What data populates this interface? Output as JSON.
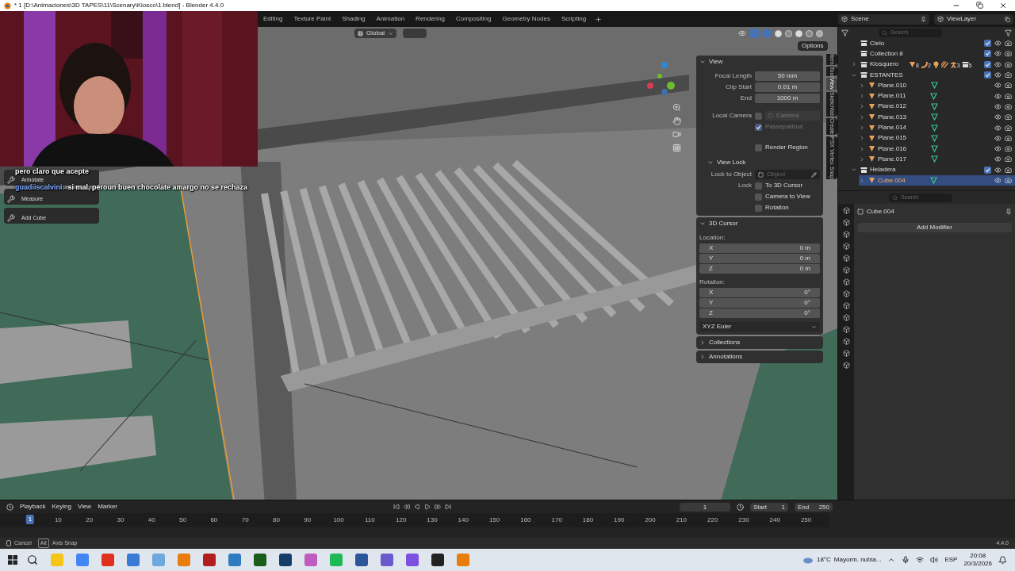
{
  "title_bar": {
    "title": "* 1 [D:\\Animaciones\\3D TAPES\\11\\Scenary\\Kiosco\\1.blend] - Blender 4.4.0"
  },
  "workspaces": [
    {
      "label": "Editing",
      "selected": false
    },
    {
      "label": "Texture Paint",
      "selected": false
    },
    {
      "label": "Shading",
      "selected": false
    },
    {
      "label": "Animation",
      "selected": false
    },
    {
      "label": "Rendering",
      "selected": false
    },
    {
      "label": "Compositing",
      "selected": false
    },
    {
      "label": "Geometry Nodes",
      "selected": false
    },
    {
      "label": "Scripting",
      "selected": false
    }
  ],
  "scene": "Scene",
  "view_layer": "ViewLayer",
  "viewport": {
    "orientation": "Global",
    "options": "Options"
  },
  "tools": [
    {
      "label": "Annotate"
    },
    {
      "label": "Measure"
    },
    {
      "label": "Add Cube"
    }
  ],
  "chat": [
    {
      "text": "pero claro que acepte"
    },
    {
      "user": "guadiiscalvini:",
      "text": "si mal, peroun buen chocolate amargo no se rechaza"
    }
  ],
  "n_panel": {
    "view": {
      "title": "View",
      "expanded": true,
      "fields": [
        {
          "label": "Focal Length",
          "value": "50 mm"
        },
        {
          "label": "Clip Start",
          "value": "0.01 m"
        },
        {
          "label": "End",
          "value": "1000 m"
        }
      ],
      "local_camera": {
        "label": "Local Camera",
        "checked": false,
        "placeholder": "Camera"
      },
      "passepartout": {
        "label": "Passepartout",
        "checked": true,
        "disabled": true
      },
      "render_region": {
        "label": "Render Region",
        "checked": false
      },
      "view_lock": {
        "title": "View Lock",
        "expanded": true,
        "lock_object_label": "Lock to Object",
        "lock_object_placeholder": "Object",
        "lock_label": "Lock",
        "options": [
          {
            "label": "To 3D Cursor",
            "checked": false
          },
          {
            "label": "Camera to View",
            "checked": false
          },
          {
            "label": "Rotation",
            "checked": false
          }
        ]
      }
    },
    "cursor": {
      "title": "3D Cursor",
      "expanded": true,
      "location_label": "Location:",
      "location": [
        {
          "axis": "X",
          "value": "0 m"
        },
        {
          "axis": "Y",
          "value": "0 m"
        },
        {
          "axis": "Z",
          "value": "0 m"
        }
      ],
      "rotation_label": "Rotation:",
      "rotation": [
        {
          "axis": "X",
          "value": "0°"
        },
        {
          "axis": "Y",
          "value": "0°"
        },
        {
          "axis": "Z",
          "value": "0°"
        }
      ],
      "mode": "XYZ Euler"
    },
    "collapsed": [
      {
        "title": "Collections",
        "expanded": false
      },
      {
        "title": "Annotations",
        "expanded": false
      }
    ]
  },
  "side_tabs": [
    {
      "label": "Item",
      "selected": false
    },
    {
      "label": "Tool",
      "selected": false
    },
    {
      "label": "View",
      "selected": true
    },
    {
      "label": "Sketchfab",
      "selected": false
    },
    {
      "label": "Create",
      "selected": false
    },
    {
      "label": "PSX Vertex Snap",
      "selected": false
    }
  ],
  "outliner": {
    "search_placeholder": "Search",
    "items": [
      {
        "name": "Cielo",
        "kind": "collection",
        "expandable": false,
        "expanded": false,
        "checked": true,
        "selected": false
      },
      {
        "name": "Collection 8",
        "kind": "collection",
        "expandable": false,
        "expanded": false,
        "checked": true,
        "selected": false
      },
      {
        "name": "Kiosquero",
        "kind": "collection",
        "expandable": true,
        "expanded": false,
        "checked": true,
        "selected": false,
        "contents": [
          {
            "kind": "mesh",
            "count": "8"
          },
          {
            "kind": "curve",
            "count": "2"
          },
          {
            "kind": "light"
          },
          {
            "kind": "hair"
          },
          {
            "kind": "armature",
            "count": "3"
          },
          {
            "kind": "collection",
            "count": "5"
          }
        ]
      },
      {
        "name": "ESTANTES",
        "kind": "collection",
        "expandable": true,
        "expanded": true,
        "checked": true,
        "selected": false,
        "children": [
          {
            "name": "Plane.010",
            "kind": "object",
            "expandable": true,
            "expanded": false,
            "selected": false
          },
          {
            "name": "Plane.011",
            "kind": "object",
            "expandable": true,
            "expanded": false,
            "selected": false
          },
          {
            "name": "Plane.012",
            "kind": "object",
            "expandable": true,
            "expanded": false,
            "selected": false
          },
          {
            "name": "Plane.013",
            "kind": "object",
            "expandable": true,
            "expanded": false,
            "selected": false
          },
          {
            "name": "Plane.014",
            "kind": "object",
            "expandable": true,
            "expanded": false,
            "selected": false
          },
          {
            "name": "Plane.015",
            "kind": "object",
            "expandable": true,
            "expanded": false,
            "selected": false
          },
          {
            "name": "Plane.016",
            "kind": "object",
            "expandable": true,
            "expanded": false,
            "selected": false
          },
          {
            "name": "Plane.017",
            "kind": "object",
            "expandable": true,
            "expanded": false,
            "selected": false
          }
        ]
      },
      {
        "name": "Heladera",
        "kind": "collection",
        "expandable": true,
        "expanded": true,
        "checked": true,
        "selected": false,
        "children": [
          {
            "name": "Cube.004",
            "kind": "object",
            "expandable": true,
            "expanded": false,
            "selected": true
          }
        ]
      }
    ]
  },
  "properties": {
    "search_placeholder": "Search",
    "object": "Cube.004",
    "add_modifier": "Add Modifier"
  },
  "timeline": {
    "menus": [
      "Playback",
      "Keying",
      "View",
      "Marker"
    ],
    "frame": "1",
    "start_label": "Start",
    "start": "1",
    "end_label": "End",
    "end": "250",
    "current": "1",
    "ticks": [
      "10",
      "20",
      "30",
      "40",
      "50",
      "60",
      "70",
      "80",
      "90",
      "100",
      "110",
      "120",
      "130",
      "140",
      "150",
      "160",
      "170",
      "180",
      "190",
      "200",
      "210",
      "220",
      "230",
      "240",
      "250"
    ]
  },
  "status_bar": {
    "items": [
      {
        "label": "Cancel"
      },
      {
        "key": "Alt",
        "label": "Axis Snap"
      }
    ],
    "version": "4.4.0"
  },
  "taskbar": {
    "temperature": "18°C",
    "weather": "Mayorm. nubla...",
    "language": "ESP",
    "time": "20:08",
    "date": "20/3/2026"
  }
}
